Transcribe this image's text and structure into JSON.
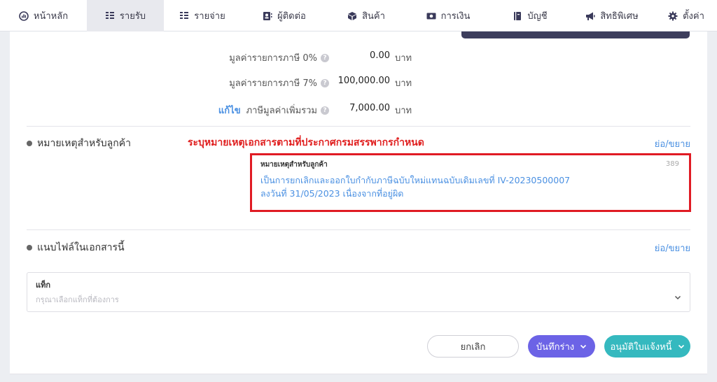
{
  "nav": {
    "items": [
      {
        "label": "หน้าหลัก",
        "icon": "dashboard-icon"
      },
      {
        "label": "รายรับ",
        "icon": "income-icon",
        "active": true
      },
      {
        "label": "รายจ่าย",
        "icon": "expense-icon"
      },
      {
        "label": "ผู้ติดต่อ",
        "icon": "contacts-icon"
      },
      {
        "label": "สินค้า",
        "icon": "box-icon"
      },
      {
        "label": "การเงิน",
        "icon": "money-icon"
      },
      {
        "label": "บัญชี",
        "icon": "book-icon"
      },
      {
        "label": "สิทธิพิเศษ",
        "icon": "megaphone-icon"
      },
      {
        "label": "ตั้งค่า",
        "icon": "gear-icon"
      }
    ]
  },
  "summary": {
    "rows": [
      {
        "label": "มูลค่ารายการภาษี 0%",
        "value": "0.00",
        "unit": "บาท"
      },
      {
        "label": "มูลค่ารายการภาษี 7%",
        "value": "100,000.00",
        "unit": "บาท"
      },
      {
        "edit": "แก้ไข",
        "label": "ภาษีมูลค่าเพิ่มรวม",
        "value": "7,000.00",
        "unit": "บาท"
      }
    ]
  },
  "remarks": {
    "section_title": "หมายเหตุสำหรับลูกค้า",
    "annotation": "ระบุหมายเหตุเอกสารตามที่ประกาศกรมสรรพากรกำหนด",
    "collapse": "ย่อ/ขยาย",
    "field_label": "หมายเหตุสำหรับลูกค้า",
    "char_count": "389",
    "text_line1": "เป็นการยกเลิกและออกใบกำกับภาษีฉบับใหม่แทนฉบับเดิมเลขที่ IV-20230500007",
    "text_line2": "ลงวันที่ 31/05/2023 เนื่องจากที่อยู่ผิด"
  },
  "attachments": {
    "section_title": "แนบไฟล์ในเอกสารนี้",
    "collapse": "ย่อ/ขยาย",
    "tag_label": "แท็ก",
    "tag_placeholder": "กรุณาเลือกแท็กที่ต้องการ"
  },
  "actions": {
    "cancel": "ยกเลิก",
    "save_draft": "บันทึกร่าง",
    "approve": "อนุมัติใบแจ้งหนี้"
  },
  "colors": {
    "accent_blue": "#4a90e2",
    "draft_button": "#6c63e6",
    "approve_button": "#35b9bf",
    "annotation_red": "#e02020"
  }
}
